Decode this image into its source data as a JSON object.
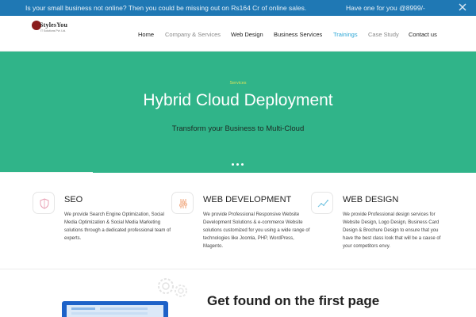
{
  "promo": {
    "message": "Is your small business not online? Then you could be missing out on Rs164 Cr of online sales.",
    "offer": "Have one for you @8999/-",
    "close_icon": "close-icon"
  },
  "header": {
    "logo_text": "StylesYou",
    "logo_tagline": "IT Solutions Pvt. Ltd.",
    "nav": [
      {
        "label": "Home"
      },
      {
        "label": "Company & Services"
      },
      {
        "label": "Web Design"
      },
      {
        "label": "Business Services"
      },
      {
        "label": "Trainings"
      },
      {
        "label": "Case Study"
      },
      {
        "label": "Contact us"
      }
    ]
  },
  "hero": {
    "badge": "Services",
    "title": "Hybrid Cloud Deployment",
    "subtitle": "Transform your Business to Multi-Cloud",
    "slides": 3,
    "active_slide": 1,
    "colors": {
      "background": "#30b489",
      "badge": "#d8e25a"
    }
  },
  "services": [
    {
      "title": "SEO",
      "icon": "shield-icon",
      "description": "We provide Search Engine Optimization, Social Media Optimization & Social Media Marketing solutions through a dedicated professional team of experts."
    },
    {
      "title": "WEB DEVELOPMENT",
      "icon": "sliders-icon",
      "description": "We provide Professional Responsive Website Development Solutions & e-commerce Website solutions customized for you using a wide range of technologies like Joomla, PHP, WordPress, Magento."
    },
    {
      "title": "WEB DESIGN",
      "icon": "trend-chart-icon",
      "description": "We provide Professional design services for Website Design, Logo Design, Business Card Design & Brochure Design to ensure that you have the best class look that will be a cause of your competitors envy."
    }
  ],
  "section": {
    "heading": "Get found on the first page"
  },
  "colors": {
    "promo_bar": "#1f78b4",
    "accent": "#2ba6d6"
  }
}
